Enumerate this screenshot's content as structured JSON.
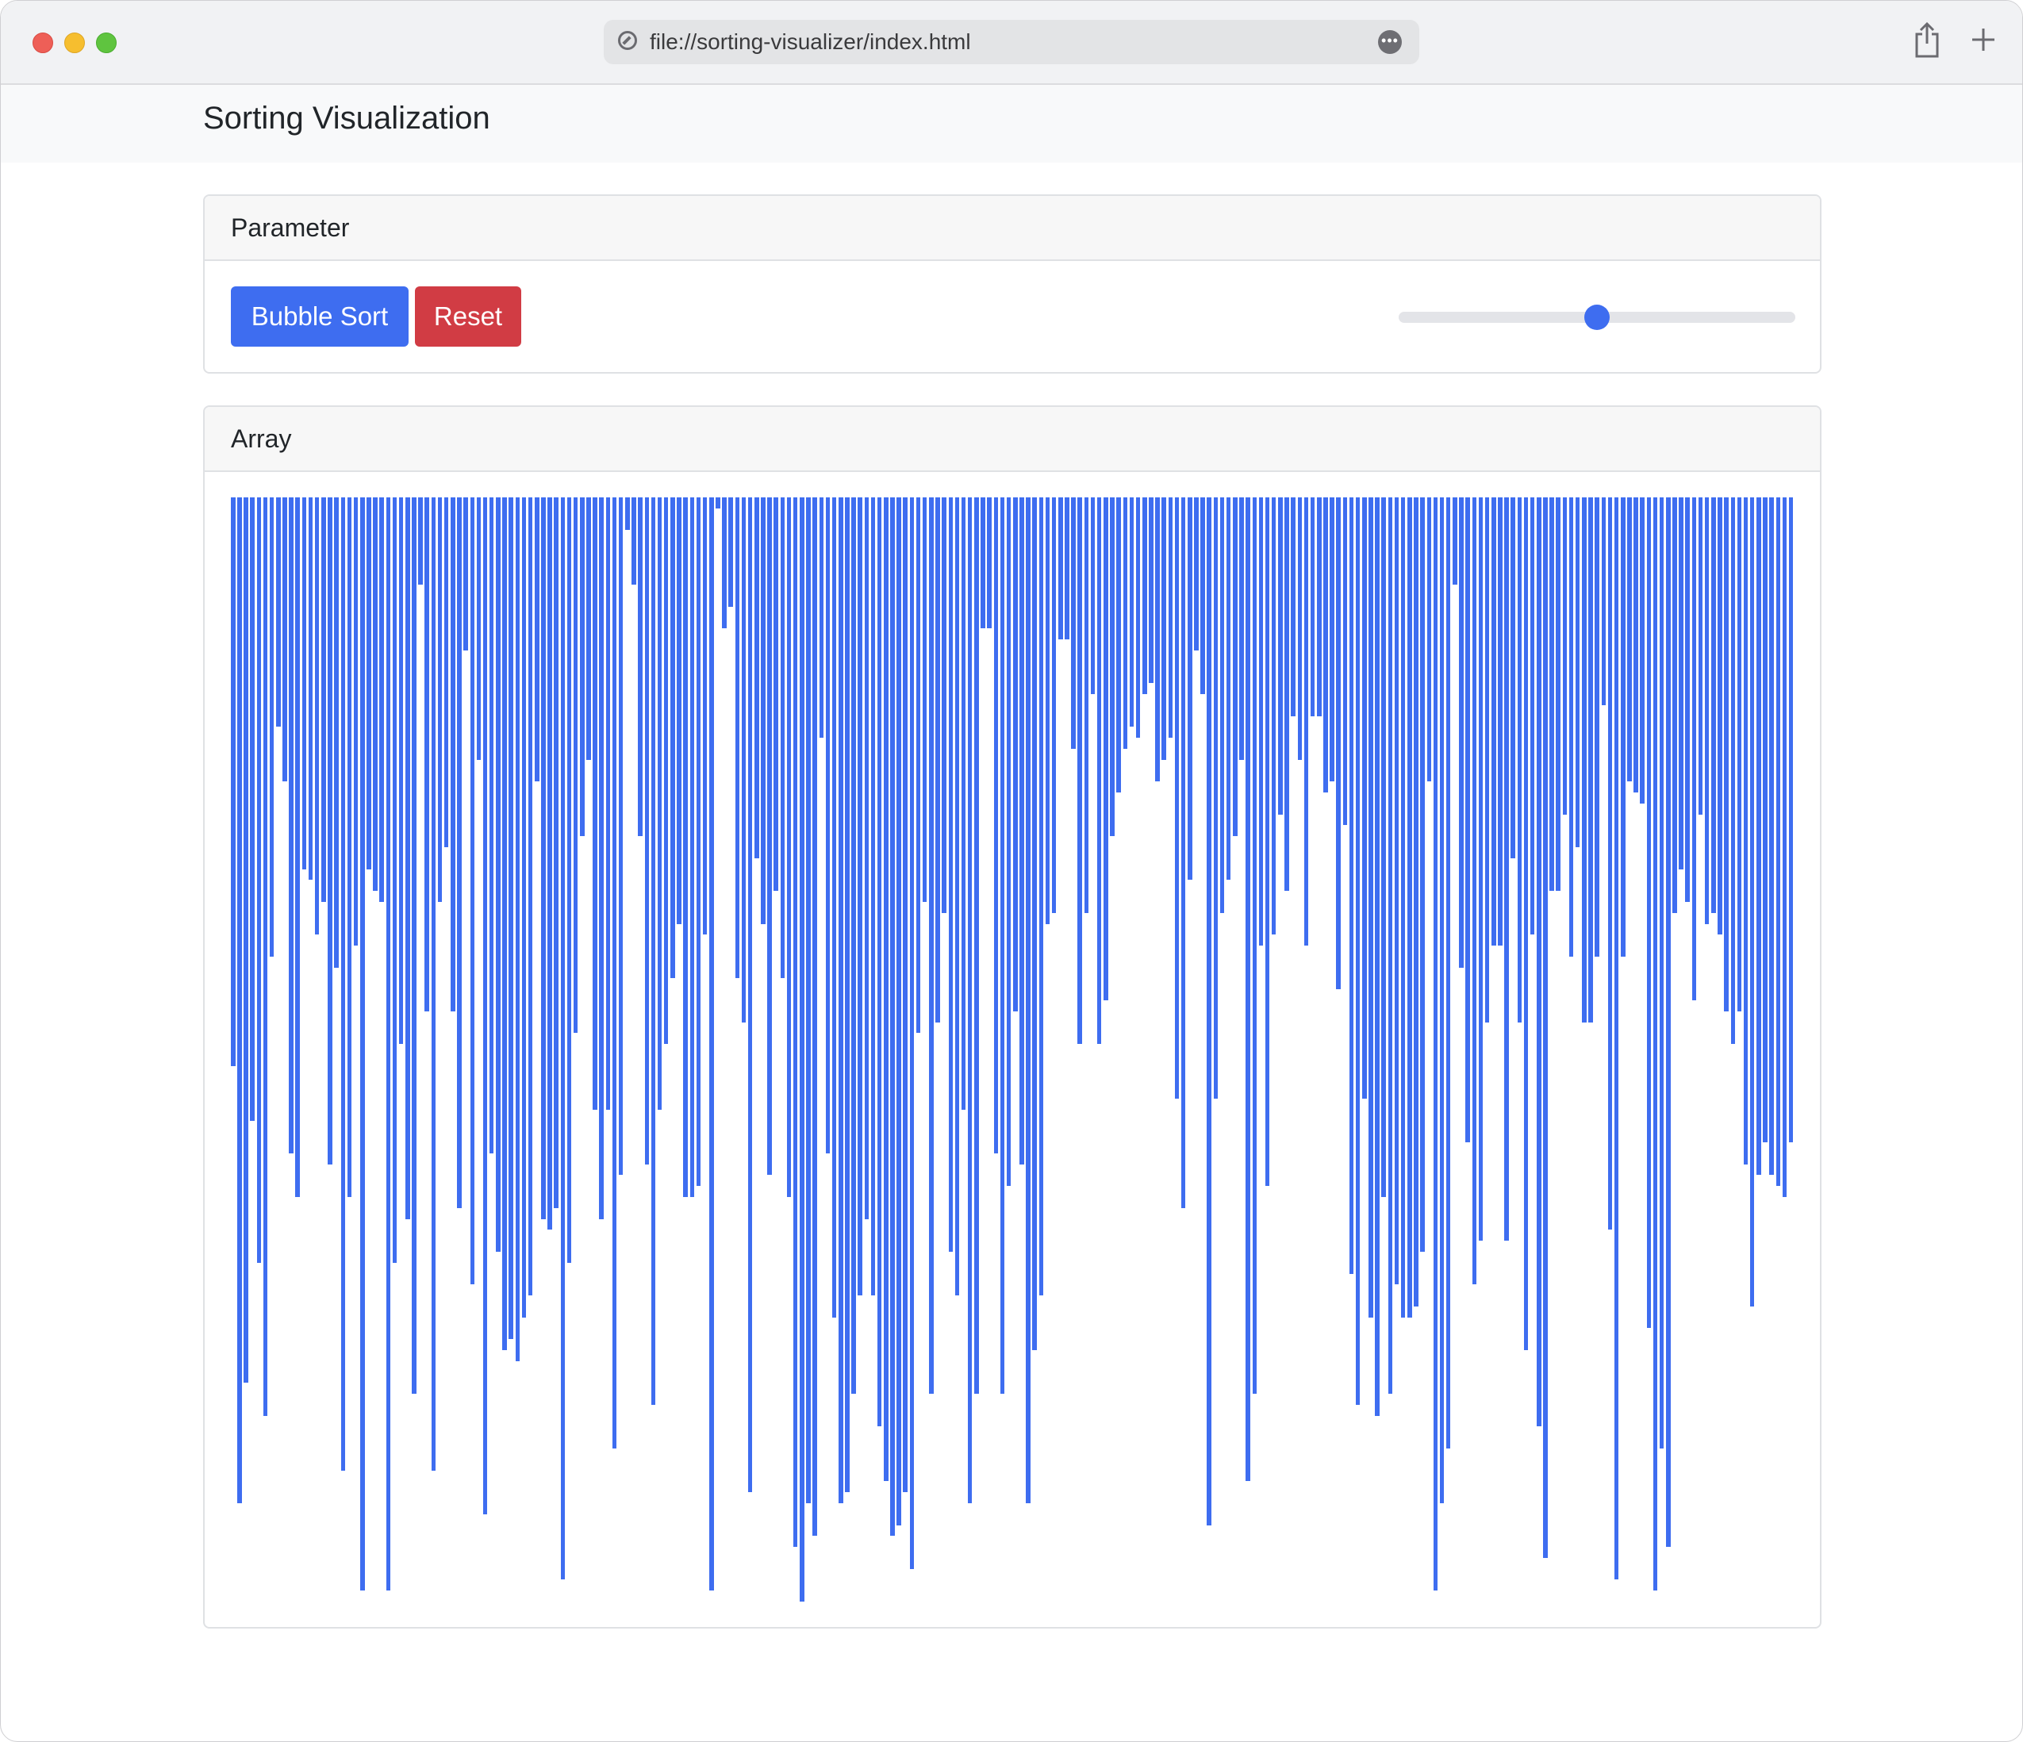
{
  "browser": {
    "url": "file://sorting-visualizer/index.html"
  },
  "navbar": {
    "brand": "Sorting Visualization"
  },
  "parameter_card": {
    "header": "Parameter",
    "bubble_sort_label": "Bubble Sort",
    "reset_label": "Reset",
    "speed_slider_fraction": 0.5
  },
  "array_card": {
    "header": "Array"
  },
  "colors": {
    "primary": "#3e6df0",
    "danger": "#d13c44",
    "bar": "#3e6df0"
  },
  "array": {
    "max_value": 100,
    "values": [
      52,
      92,
      81,
      57,
      70,
      84,
      42,
      21,
      26,
      60,
      64,
      34,
      35,
      40,
      37,
      61,
      43,
      89,
      64,
      41,
      100,
      34,
      36,
      37,
      100,
      70,
      50,
      66,
      82,
      8,
      47,
      89,
      37,
      32,
      47,
      65,
      14,
      72,
      24,
      93,
      60,
      69,
      78,
      77,
      79,
      75,
      73,
      26,
      66,
      67,
      65,
      99,
      70,
      49,
      31,
      24,
      56,
      66,
      56,
      87,
      62,
      3,
      8,
      31,
      61,
      83,
      56,
      50,
      44,
      39,
      64,
      64,
      63,
      40,
      100,
      1,
      12,
      10,
      44,
      48,
      91,
      33,
      39,
      62,
      36,
      44,
      64,
      96,
      101,
      92,
      95,
      22,
      60,
      75,
      92,
      91,
      82,
      73,
      66,
      73,
      85,
      90,
      95,
      94,
      91,
      98,
      49,
      37,
      82,
      48,
      38,
      69,
      73,
      56,
      92,
      82,
      12,
      12,
      60,
      82,
      63,
      47,
      61,
      92,
      78,
      73,
      39,
      38,
      13,
      13,
      23,
      50,
      38,
      18,
      50,
      46,
      31,
      27,
      23,
      21,
      22,
      18,
      17,
      26,
      24,
      22,
      55,
      65,
      35,
      14,
      18,
      94,
      55,
      38,
      35,
      31,
      24,
      90,
      82,
      41,
      63,
      40,
      29,
      36,
      20,
      24,
      41,
      20,
      20,
      27,
      26,
      45,
      30,
      71,
      83,
      55,
      75,
      84,
      64,
      82,
      72,
      75,
      75,
      74,
      69,
      26,
      100,
      92,
      87,
      8,
      43,
      59,
      72,
      68,
      48,
      41,
      41,
      68,
      33,
      48,
      78,
      40,
      85,
      97,
      36,
      36,
      29,
      42,
      32,
      48,
      48,
      42,
      19,
      67,
      99,
      42,
      26,
      27,
      28,
      76,
      100,
      87,
      96,
      38,
      34,
      37,
      46,
      29,
      39,
      38,
      40,
      47,
      50,
      47,
      61,
      74,
      62,
      59,
      62,
      63,
      64,
      59
    ]
  }
}
